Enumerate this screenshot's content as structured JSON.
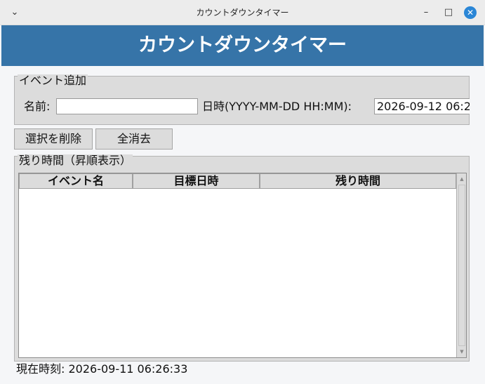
{
  "window": {
    "title": "カウントダウンタイマー",
    "menu_icon": "chevron-down-icon",
    "minimize_icon": "minimize-icon",
    "maximize_icon": "maximize-icon",
    "close_icon": "close-icon"
  },
  "banner": {
    "title": "カウントダウンタイマー",
    "color": "#3674a8"
  },
  "add_event": {
    "legend": "イベント追加",
    "name_label": "名前:",
    "name_value": "",
    "datetime_label": "日時(YYYY-MM-DD HH:MM):",
    "datetime_value": "2026-09-12 06:2"
  },
  "buttons": {
    "delete_selected": "選択を削除",
    "clear_all": "全消去"
  },
  "remaining": {
    "legend": "残り時間（昇順表示）",
    "columns": [
      "イベント名",
      "目標日時",
      "残り時間"
    ],
    "rows": []
  },
  "status": {
    "current_time": "現在時刻: 2026-09-11 06:26:33"
  }
}
